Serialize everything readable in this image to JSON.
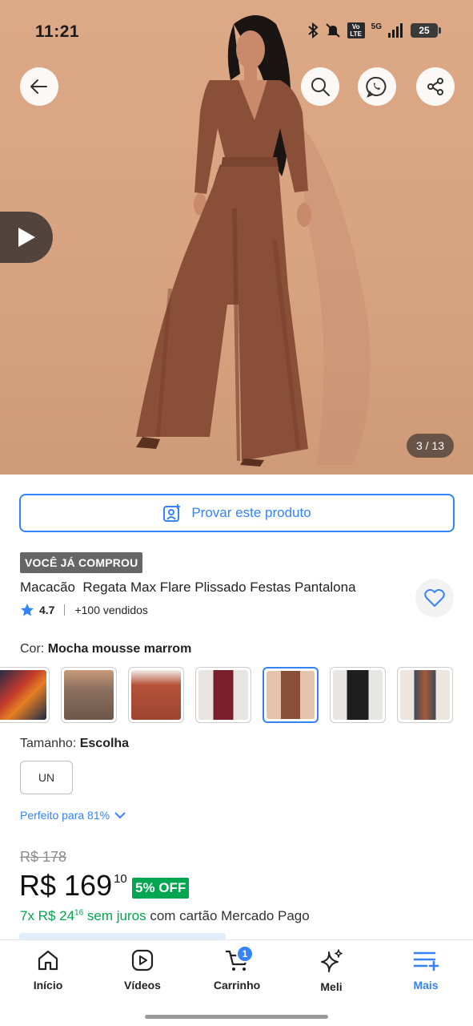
{
  "status_bar": {
    "time": "11:21",
    "network_label": "5G",
    "volte_label": "Vo LTE",
    "battery": "25"
  },
  "hero": {
    "image_counter": "3 / 13",
    "background_color": "#d9a483",
    "garment_color": "#8a4f38"
  },
  "try_on_button": {
    "label": "Provar este produto"
  },
  "badge": {
    "label": "VOCÊ JÁ COMPROU"
  },
  "product": {
    "title": "Macacão  Regata Max Flare Plissado Festas Pantalona",
    "rating": "4.7",
    "sold": "+100 vendidos"
  },
  "color": {
    "label": "Cor:",
    "value": "Mocha mousse marrom",
    "swatches": [
      {
        "name": "floral-red",
        "color": "#c0392b"
      },
      {
        "name": "print-brown",
        "color": "#8b6f5e"
      },
      {
        "name": "rust",
        "color": "#b5533a"
      },
      {
        "name": "burgundy",
        "color": "#7a1f2b"
      },
      {
        "name": "mocha",
        "color": "#8a4f38",
        "selected": true
      },
      {
        "name": "black",
        "color": "#1e1e1e"
      },
      {
        "name": "floral-dark",
        "color": "#3d4a5a"
      }
    ]
  },
  "size": {
    "label": "Tamanho:",
    "value": "Escolha",
    "options": [
      "UN"
    ]
  },
  "fit_link": {
    "label": "Perfeito para 81%"
  },
  "pricing": {
    "old_price": "R$ 178",
    "price_main": "R$ 169",
    "price_cents": "10",
    "discount": "5% OFF",
    "installments_prefix": "7x R$ 24",
    "installments_cents": "16",
    "installments_interest": " sem juros",
    "installments_suffix": " com cartão Mercado Pago"
  },
  "bottom_nav": {
    "items": [
      {
        "label": "Início",
        "icon": "home-icon"
      },
      {
        "label": "Vídeos",
        "icon": "video-icon"
      },
      {
        "label": "Carrinho",
        "icon": "cart-icon",
        "badge": "1"
      },
      {
        "label": "Meli",
        "icon": "sparkle-icon"
      },
      {
        "label": "Mais",
        "icon": "menu-plus-icon",
        "active": true
      }
    ]
  },
  "colors": {
    "accent": "#3483fa",
    "success": "#00a650",
    "badge_gray": "#666666"
  }
}
